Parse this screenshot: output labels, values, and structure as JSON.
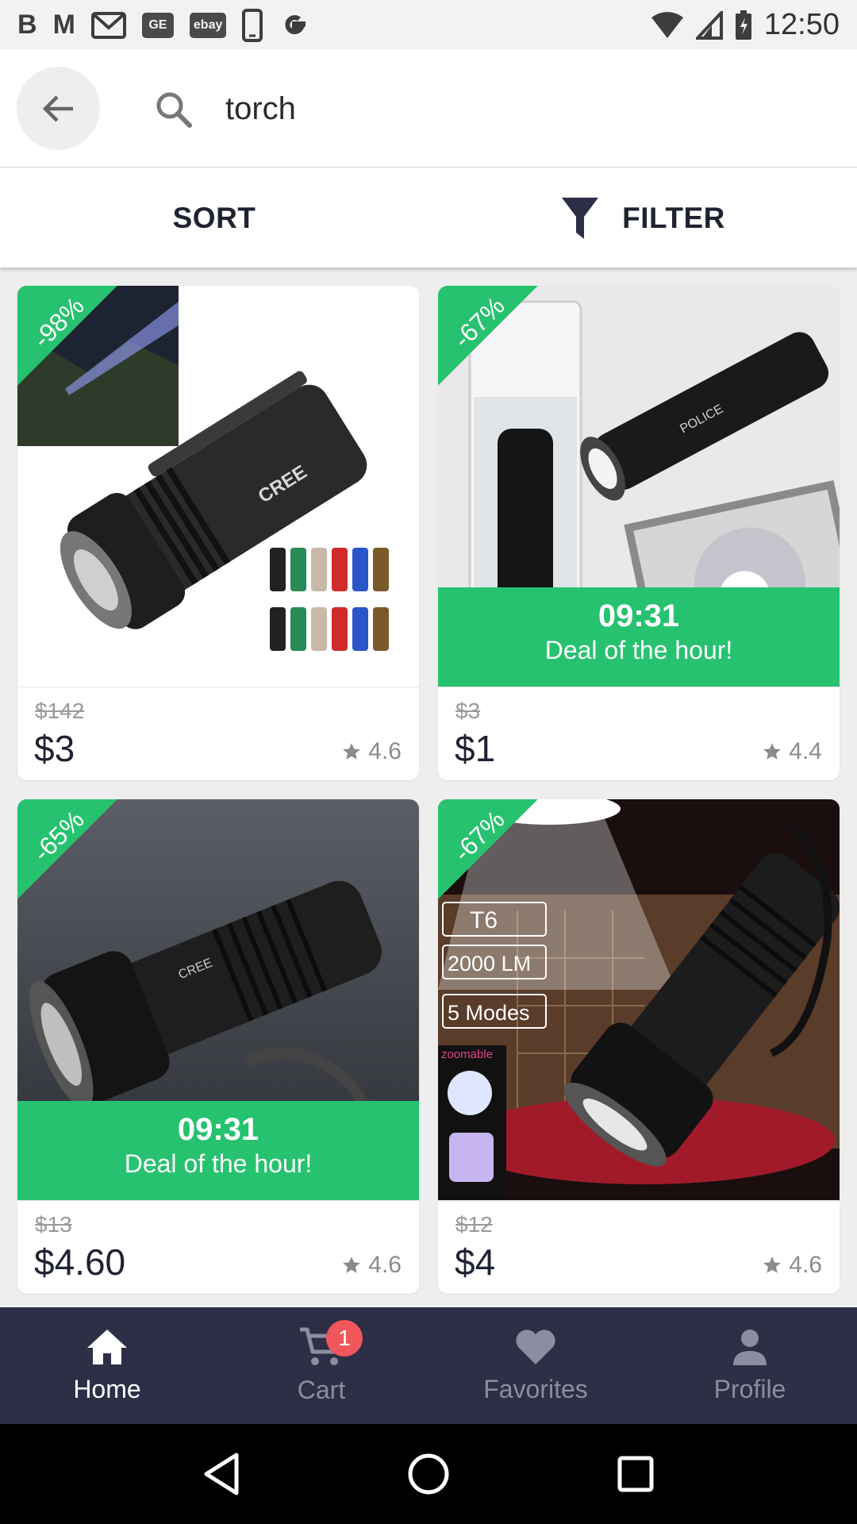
{
  "status_bar": {
    "time": "12:50",
    "notification_icons": [
      "b-icon",
      "m-icon",
      "gmail-icon",
      "ge-icon",
      "ebay-icon",
      "phone-icon",
      "google-icon"
    ],
    "ebay_label": "ebay",
    "ge_label": "GE"
  },
  "search": {
    "query": "torch"
  },
  "toolbar": {
    "sort_label": "SORT",
    "filter_label": "FILTER"
  },
  "products": [
    {
      "discount": "-98%",
      "old_price": "$142",
      "price": "$3",
      "rating": "4.6",
      "deal": null
    },
    {
      "discount": "-67%",
      "old_price": "$3",
      "price": "$1",
      "rating": "4.4",
      "deal": {
        "time": "09:31",
        "text": "Deal of the hour!"
      }
    },
    {
      "discount": "-65%",
      "old_price": "$13",
      "price": "$4.60",
      "rating": "4.6",
      "deal": {
        "time": "09:31",
        "text": "Deal of the hour!"
      }
    },
    {
      "discount": "-67%",
      "old_price": "$12",
      "price": "$4",
      "rating": "4.6",
      "deal": null,
      "image_labels": [
        "T6",
        "2000 LM",
        "5 Modes",
        "zoomable"
      ]
    }
  ],
  "image_text": {
    "cree": "CREE",
    "police": "POLICE"
  },
  "bottom_nav": {
    "items": [
      {
        "label": "Home",
        "icon": "home-icon",
        "active": true
      },
      {
        "label": "Cart",
        "icon": "cart-icon",
        "badge": "1"
      },
      {
        "label": "Favorites",
        "icon": "heart-icon"
      },
      {
        "label": "Profile",
        "icon": "person-icon"
      }
    ]
  },
  "colors": {
    "accent_green": "#27c26f",
    "nav_background": "#2c2f45",
    "badge_red": "#f0565b"
  }
}
